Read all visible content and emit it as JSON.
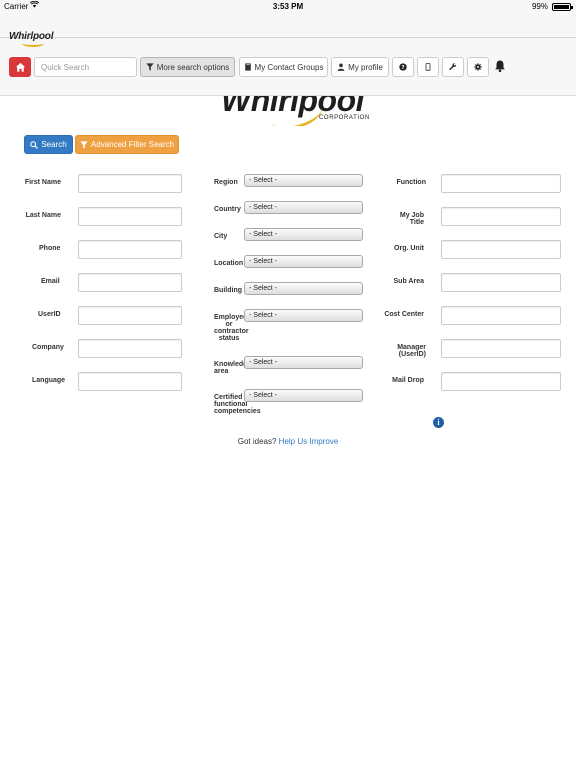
{
  "status_bar": {
    "carrier": "Carrier",
    "time": "3:53 PM",
    "battery": "99%",
    "battery_level": 0.99
  },
  "header": {
    "logo_text": "Whirlpool",
    "toolbar": {
      "quick_search_placeholder": "Quick Search",
      "more_search_options": "More search options",
      "my_contact_groups": "My Contact Groups",
      "my_profile": "My profile"
    }
  },
  "brand": {
    "logo_word": "Whirlpool",
    "logo_sub": "CORPORATION",
    "accent_color": "#e9b422"
  },
  "actions": {
    "search_label": "Search",
    "advanced_filter_label": "Advanced Filter Search",
    "primary_color": "#3379c4",
    "secondary_color": "#efa040"
  },
  "form": {
    "left_fields": [
      {
        "label": "First Name"
      },
      {
        "label": "Last Name"
      },
      {
        "label": "Phone"
      },
      {
        "label": "Email"
      },
      {
        "label": "UserID"
      },
      {
        "label": "Company"
      },
      {
        "label": "Language"
      }
    ],
    "middle_fields": [
      {
        "label": "Region",
        "value": "- Select -"
      },
      {
        "label": "Country",
        "value": "- Select -"
      },
      {
        "label": "City",
        "value": "- Select -"
      },
      {
        "label": "Location",
        "value": "- Select -"
      },
      {
        "label": "Building",
        "value": "- Select -"
      },
      {
        "label": "Employee or contractor status",
        "value": "- Select -"
      },
      {
        "label": "Knowledge area",
        "value": "- Select -"
      },
      {
        "label": "Certified functional competencies",
        "value": "- Select -"
      }
    ],
    "right_fields": [
      {
        "label": "Function"
      },
      {
        "label": "My Job Title"
      },
      {
        "label": "Org. Unit"
      },
      {
        "label": "Sub Area"
      },
      {
        "label": "Cost Center"
      },
      {
        "label": "Manager (UserID)"
      },
      {
        "label": "Mail Drop"
      }
    ]
  },
  "footer": {
    "prompt": "Got ideas?",
    "link": "Help Us Improve"
  }
}
